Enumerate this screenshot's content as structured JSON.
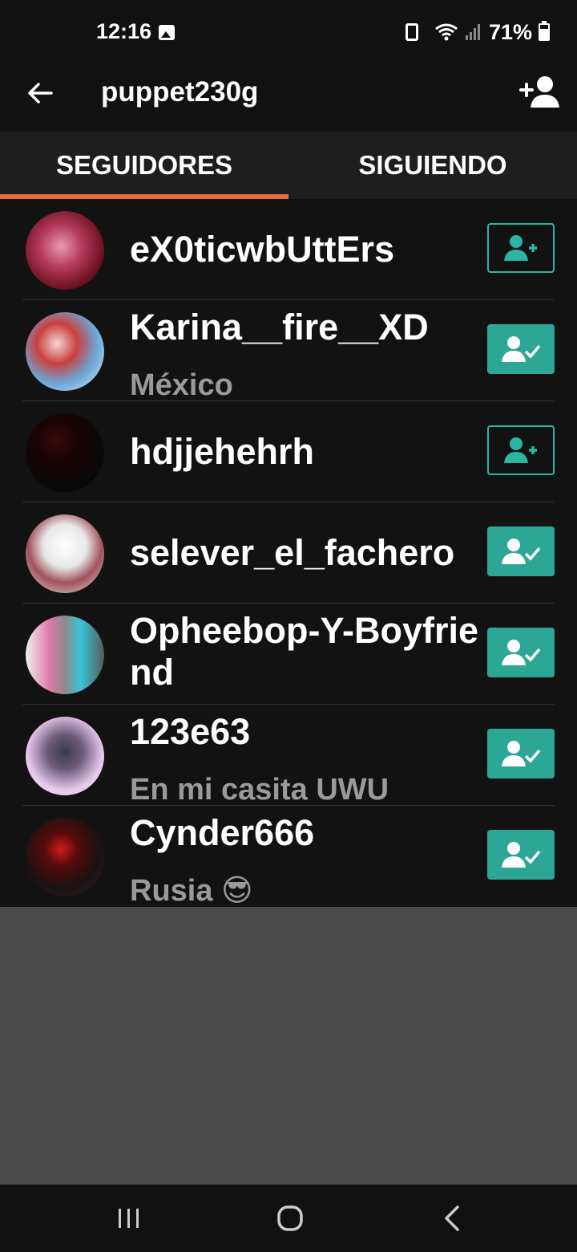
{
  "status_bar": {
    "time": "12:16",
    "battery": "71%"
  },
  "app_bar": {
    "title": "puppet230g"
  },
  "tabs": [
    {
      "label": "SEGUIDORES",
      "active": true
    },
    {
      "label": "SIGUIENDO",
      "active": false
    }
  ],
  "users": [
    {
      "name": "eX0ticwbUttErs",
      "subtitle": "",
      "following": false,
      "avatar_color": "#8a1e3a"
    },
    {
      "name": "Karina__fire__XD",
      "subtitle": "México",
      "following": true,
      "avatar_color": "#d9e4f2"
    },
    {
      "name": "hdjjehehrh",
      "subtitle": "",
      "following": false,
      "avatar_color": "#0d0d0d"
    },
    {
      "name": "selever_el_fachero",
      "subtitle": "",
      "following": true,
      "avatar_color": "#eeeeee"
    },
    {
      "name": "Opheebop-Y-Boyfriend",
      "subtitle": "",
      "following": true,
      "avatar_color": "#b7b7b7"
    },
    {
      "name": "123e63",
      "subtitle": "En mi casita UWU",
      "following": true,
      "avatar_color": "#e6c9ea"
    },
    {
      "name": "Cynder666",
      "subtitle": "Rusia 😎",
      "following": true,
      "avatar_color": "#1a1010"
    }
  ],
  "colors": {
    "accent": "#f06b3c",
    "follow_teal": "#2ca795",
    "background": "#121212"
  }
}
